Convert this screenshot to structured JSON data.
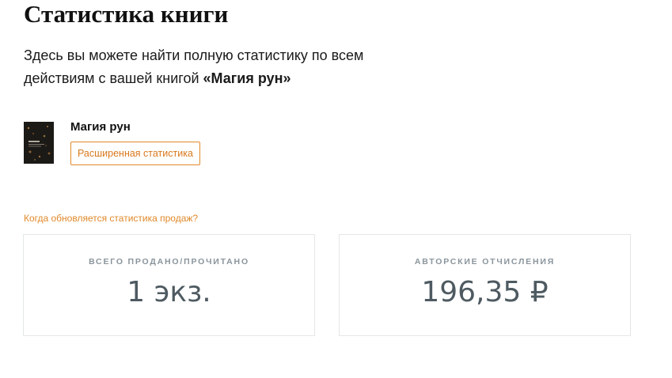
{
  "page": {
    "title": "Статистика книги",
    "intro_text": "Здесь вы можете найти полную статистику по всем действиям с вашей книгой ",
    "intro_book": "«Магия рун»"
  },
  "book": {
    "title": "Магия рун",
    "cover_icon": "book-cover-image",
    "extended_stats_label": "Расширенная статистика"
  },
  "update_link": "Когда обновляется статистика продаж?",
  "stats": {
    "sold": {
      "label": "Всего продано/прочитано",
      "value": "1 экз."
    },
    "royalties": {
      "label": "Авторские отчисления",
      "value": "196,35 ₽"
    }
  },
  "colors": {
    "accent": "#e0892a",
    "stat_value": "#4e5a61",
    "stat_label": "#8a959c",
    "card_border": "#e3e6e8"
  }
}
